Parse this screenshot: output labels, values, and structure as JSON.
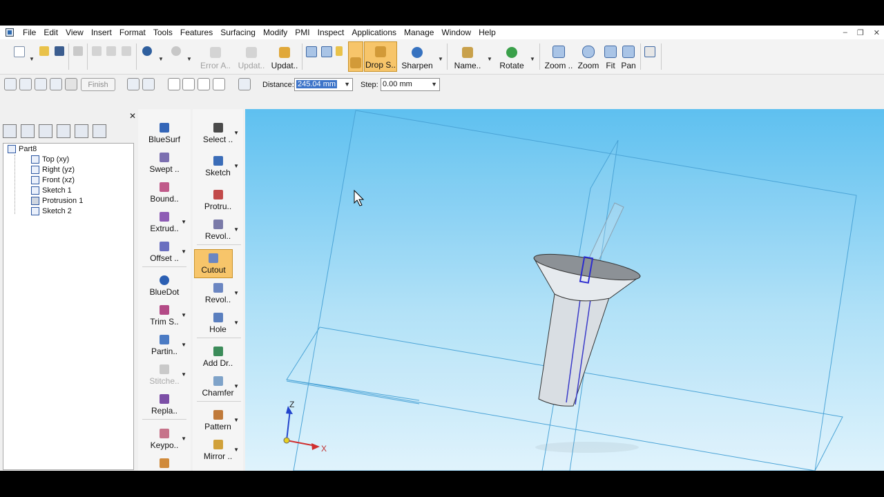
{
  "menu": [
    "File",
    "Edit",
    "View",
    "Insert",
    "Format",
    "Tools",
    "Features",
    "Surfacing",
    "Modify",
    "PMI",
    "Inspect",
    "Applications",
    "Manage",
    "Window",
    "Help"
  ],
  "window_controls": [
    "–",
    "❐",
    "✕"
  ],
  "toolbar": {
    "error_label": "Error A..",
    "update1_label": "Updat..",
    "update2_label": "Updat..",
    "drop_label": "Drop S..",
    "sharpen_label": "Sharpen",
    "name_label": "Name..",
    "rotate_label": "Rotate",
    "zoom_area_label": "Zoom ..",
    "zoom_label": "Zoom",
    "fit_label": "Fit",
    "pan_label": "Pan"
  },
  "ribbon": {
    "finish_label": "Finish",
    "distance_label": "Distance:",
    "distance_value": "245.04 mm",
    "step_label": "Step:",
    "step_value": "0.00 mm"
  },
  "pathfinder": {
    "close": "✕",
    "root": "Part8",
    "items": [
      "Top (xy)",
      "Right (yz)",
      "Front (xz)",
      "Sketch 1",
      "Protrusion 1",
      "Sketch 2"
    ]
  },
  "commands_left": [
    "BlueSurf",
    "Swept ..",
    "Bound..",
    "Extrud..",
    "Offset ..",
    "BlueDot",
    "Trim S..",
    "Partin..",
    "Stitche..",
    "Repla..",
    "Keypo.."
  ],
  "commands_right": [
    "Select ..",
    "Sketch",
    "Protru..",
    "Revol..",
    "Cutout",
    "Revol..",
    "Hole",
    "Add Dr..",
    "Chamfer",
    "Pattern",
    "Mirror .."
  ],
  "triad": {
    "z": "Z",
    "x": "X"
  },
  "colors": {
    "active_button": "#f7c56a",
    "viewport_top": "#5ec0f0",
    "viewport_bottom": "#dff3fc"
  }
}
